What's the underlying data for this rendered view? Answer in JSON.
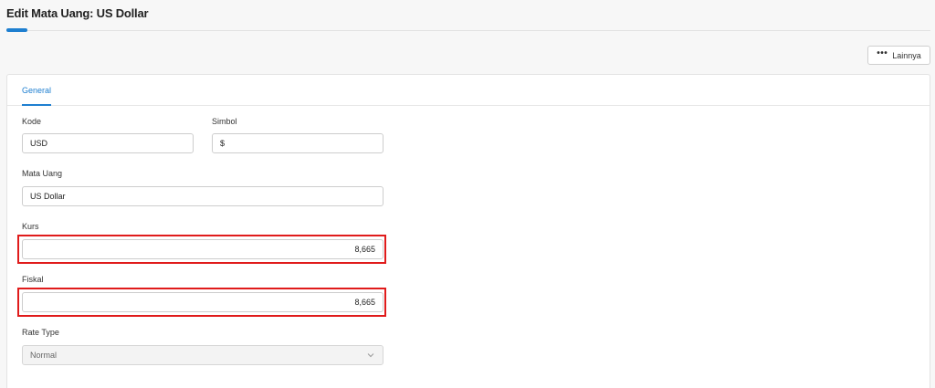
{
  "header": {
    "title": "Edit Mata Uang: US Dollar",
    "more_label": "Lainnya",
    "more_icon": "more-dots-icon"
  },
  "tabs": [
    {
      "label": "General",
      "active": true
    }
  ],
  "form": {
    "kode": {
      "label": "Kode",
      "value": "USD"
    },
    "simbol": {
      "label": "Simbol",
      "value": "$"
    },
    "mata_uang": {
      "label": "Mata Uang",
      "value": "US Dollar"
    },
    "kurs": {
      "label": "Kurs",
      "value": "8,665"
    },
    "fiskal": {
      "label": "Fiskal",
      "value": "8,665"
    },
    "rate_type": {
      "label": "Rate Type",
      "value": "Normal",
      "disabled": true,
      "icon": "chevron-down-icon"
    }
  },
  "colors": {
    "accent": "#1e7fd0",
    "highlight": "#e01b1b"
  }
}
